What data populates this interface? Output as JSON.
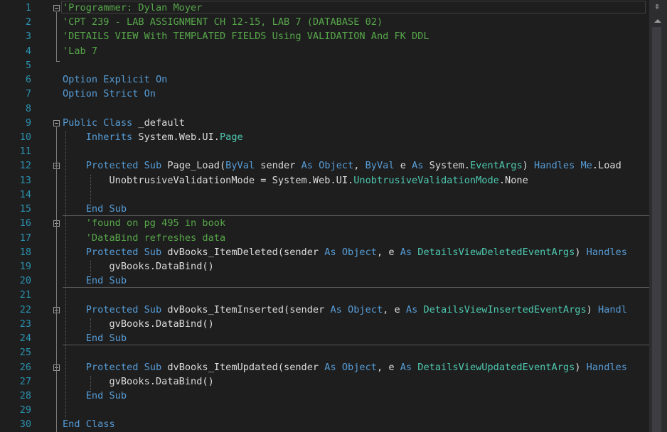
{
  "editor": {
    "line_numbers": [
      "1",
      "2",
      "3",
      "4",
      "5",
      "6",
      "7",
      "8",
      "9",
      "10",
      "11",
      "12",
      "13",
      "14",
      "15",
      "16",
      "17",
      "18",
      "19",
      "20",
      "21",
      "22",
      "23",
      "24",
      "25",
      "26",
      "27",
      "28",
      "29",
      "30"
    ],
    "lines": [
      [
        {
          "t": "'Programmer: Dylan Moyer",
          "c": "cm"
        }
      ],
      [
        {
          "t": "'CPT 239 - LAB ASSIGNMENT CH 12-15, LAB 7 (DATABASE 02)",
          "c": "cm"
        }
      ],
      [
        {
          "t": "'DETAILS VIEW With TEMPLATED FIELDS Using VALIDATION And FK DDL",
          "c": "cm"
        }
      ],
      [
        {
          "t": "'Lab 7",
          "c": "cm"
        }
      ],
      [],
      [
        {
          "t": "Option Explicit On",
          "c": "kw"
        }
      ],
      [
        {
          "t": "Option Strict On",
          "c": "kw"
        }
      ],
      [],
      [
        {
          "t": "Public Class",
          "c": "kw"
        },
        {
          "t": " _default",
          "c": "tx"
        }
      ],
      [
        {
          "t": "    Inherits",
          "c": "kw"
        },
        {
          "t": " System.Web.UI.",
          "c": "tx"
        },
        {
          "t": "Page",
          "c": "ty"
        }
      ],
      [],
      [
        {
          "t": "    Protected Sub",
          "c": "kw"
        },
        {
          "t": " Page_Load(",
          "c": "tx"
        },
        {
          "t": "ByVal",
          "c": "kw"
        },
        {
          "t": " sender ",
          "c": "tx"
        },
        {
          "t": "As",
          "c": "kw"
        },
        {
          "t": " ",
          "c": "tx"
        },
        {
          "t": "Object",
          "c": "kw"
        },
        {
          "t": ", ",
          "c": "tx"
        },
        {
          "t": "ByVal",
          "c": "kw"
        },
        {
          "t": " e ",
          "c": "tx"
        },
        {
          "t": "As",
          "c": "kw"
        },
        {
          "t": " System.",
          "c": "tx"
        },
        {
          "t": "EventArgs",
          "c": "ty"
        },
        {
          "t": ") ",
          "c": "tx"
        },
        {
          "t": "Handles Me",
          "c": "kw"
        },
        {
          "t": ".Load",
          "c": "tx"
        }
      ],
      [
        {
          "t": "        UnobtrusiveValidationMode = System.Web.UI.",
          "c": "tx"
        },
        {
          "t": "UnobtrusiveValidationMode",
          "c": "ty"
        },
        {
          "t": ".None",
          "c": "tx"
        }
      ],
      [],
      [
        {
          "t": "    End Sub",
          "c": "kw"
        }
      ],
      [
        {
          "t": "    'found on pg 495 in book",
          "c": "cm"
        }
      ],
      [
        {
          "t": "    'DataBind refreshes data",
          "c": "cm"
        }
      ],
      [
        {
          "t": "    Protected Sub",
          "c": "kw"
        },
        {
          "t": " dvBooks_ItemDeleted(sender ",
          "c": "tx"
        },
        {
          "t": "As",
          "c": "kw"
        },
        {
          "t": " ",
          "c": "tx"
        },
        {
          "t": "Object",
          "c": "kw"
        },
        {
          "t": ", e ",
          "c": "tx"
        },
        {
          "t": "As",
          "c": "kw"
        },
        {
          "t": " ",
          "c": "tx"
        },
        {
          "t": "DetailsViewDeletedEventArgs",
          "c": "ty"
        },
        {
          "t": ") ",
          "c": "tx"
        },
        {
          "t": "Handles",
          "c": "kw"
        }
      ],
      [
        {
          "t": "        gvBooks.DataBind()",
          "c": "tx"
        }
      ],
      [
        {
          "t": "    End Sub",
          "c": "kw"
        }
      ],
      [],
      [
        {
          "t": "    Protected Sub",
          "c": "kw"
        },
        {
          "t": " dvBooks_ItemInserted(sender ",
          "c": "tx"
        },
        {
          "t": "As",
          "c": "kw"
        },
        {
          "t": " ",
          "c": "tx"
        },
        {
          "t": "Object",
          "c": "kw"
        },
        {
          "t": ", e ",
          "c": "tx"
        },
        {
          "t": "As",
          "c": "kw"
        },
        {
          "t": " ",
          "c": "tx"
        },
        {
          "t": "DetailsViewInsertedEventArgs",
          "c": "ty"
        },
        {
          "t": ") ",
          "c": "tx"
        },
        {
          "t": "Handl",
          "c": "kw"
        }
      ],
      [
        {
          "t": "        gvBooks.DataBind()",
          "c": "tx"
        }
      ],
      [
        {
          "t": "    End Sub",
          "c": "kw"
        }
      ],
      [],
      [
        {
          "t": "    Protected Sub",
          "c": "kw"
        },
        {
          "t": " dvBooks_ItemUpdated(sender ",
          "c": "tx"
        },
        {
          "t": "As",
          "c": "kw"
        },
        {
          "t": " ",
          "c": "tx"
        },
        {
          "t": "Object",
          "c": "kw"
        },
        {
          "t": ", e ",
          "c": "tx"
        },
        {
          "t": "As",
          "c": "kw"
        },
        {
          "t": " ",
          "c": "tx"
        },
        {
          "t": "DetailsViewUpdatedEventArgs",
          "c": "ty"
        },
        {
          "t": ") ",
          "c": "tx"
        },
        {
          "t": "Handles",
          "c": "kw"
        }
      ],
      [
        {
          "t": "        gvBooks.DataBind()",
          "c": "tx"
        }
      ],
      [
        {
          "t": "    End Sub",
          "c": "kw"
        }
      ],
      [],
      [
        {
          "t": "End Class",
          "c": "kw"
        }
      ]
    ]
  },
  "scrollbar": {
    "split_glyph": "⇳"
  },
  "colors": {
    "background": "#1e1e1e",
    "keyword": "#569cd6",
    "comment": "#57a64a",
    "type": "#4ec9b0",
    "text": "#dcdcdc",
    "line_number": "#2b91af"
  }
}
